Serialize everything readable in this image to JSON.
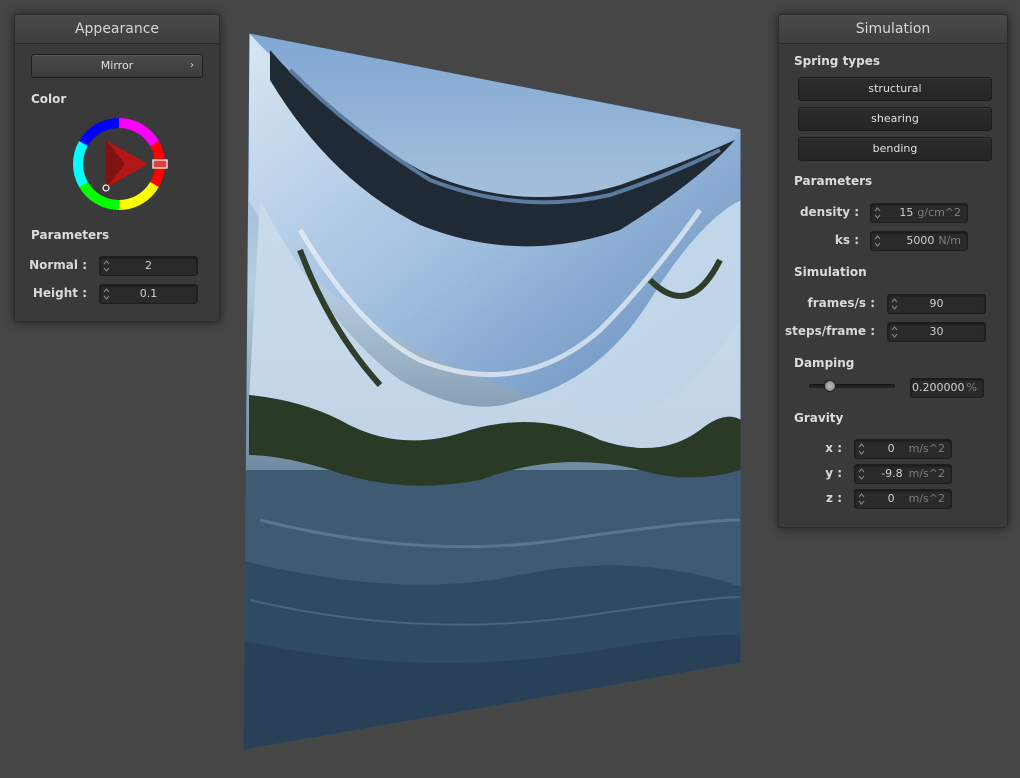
{
  "appearance": {
    "title": "Appearance",
    "shader_label": "Mirror",
    "color_label": "Color",
    "parameters_label": "Parameters",
    "normal_label": "Normal :",
    "normal_value": "2",
    "height_label": "Height :",
    "height_value": "0.1"
  },
  "simulation": {
    "title": "Simulation",
    "spring_types_label": "Spring types",
    "structural_label": "structural",
    "shearing_label": "shearing",
    "bending_label": "bending",
    "parameters_label": "Parameters",
    "density_label": "density :",
    "density_value": "15",
    "density_unit": "g/cm^2",
    "ks_label": "ks :",
    "ks_value": "5000",
    "ks_unit": "N/m",
    "simulation_label": "Simulation",
    "fps_label": "frames/s :",
    "fps_value": "90",
    "steps_label": "steps/frame :",
    "steps_value": "30",
    "damping_label": "Damping",
    "damping_value": "0.200000",
    "damping_unit": "%",
    "damping_slider_fraction": 0.2,
    "gravity_label": "Gravity",
    "gx_label": "x :",
    "gx_value": "0",
    "gy_label": "y :",
    "gy_value": "-9.8",
    "gz_label": "z :",
    "gz_value": "0",
    "gravity_unit": "m/s^2"
  },
  "colors": {
    "background": "#464646",
    "panel": "#3a3a3a",
    "selected_color": "#e02020"
  },
  "icons": {
    "spinner": "updown-spinner-icon",
    "submenu": "chevron-right-icon"
  }
}
